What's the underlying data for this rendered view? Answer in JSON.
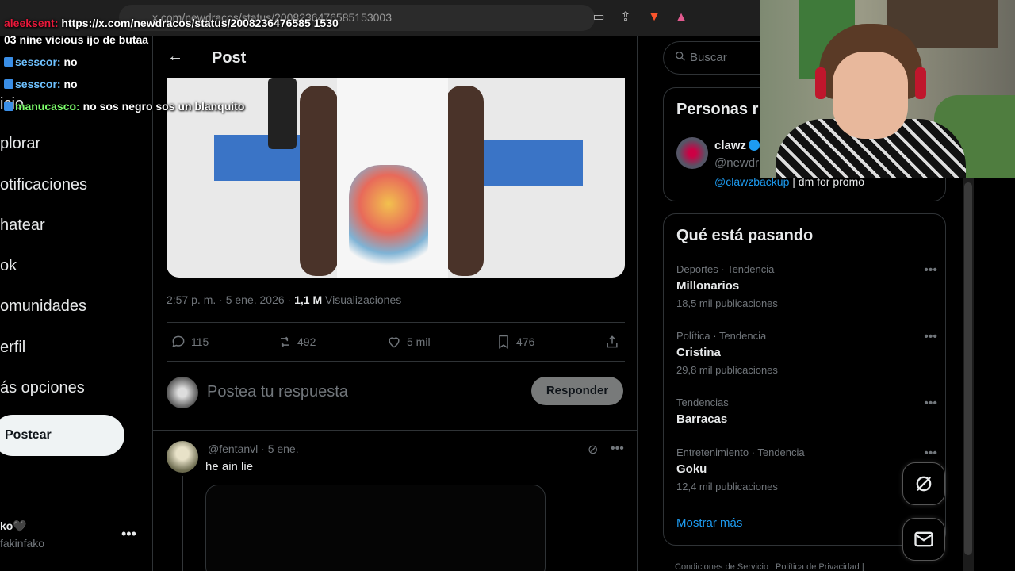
{
  "browser": {
    "url": "x.com/newdracos/status/2008236476585153003",
    "icons": [
      "cast-icon",
      "share-icon",
      "brave-icon",
      "rewards-icon"
    ]
  },
  "chat": {
    "messages": [
      {
        "user": "aleeksent:",
        "text": "https://x.com/newdracos/status/2008236476585 1530"
      },
      {
        "user": "",
        "text": "03 nine vicious ijo de butaa"
      },
      {
        "user": "sesscor:",
        "text": "no"
      },
      {
        "user": "sesscor:",
        "text": "no"
      },
      {
        "user": "manucasco:",
        "text": "no sos negro sos un blanquito"
      }
    ]
  },
  "nav": {
    "items": [
      "icio",
      "plorar",
      "otificaciones",
      "hatear",
      "ok",
      "omunidades",
      "erfil",
      "ás opciones"
    ],
    "post_button": "Postear",
    "account_name": "ko🖤",
    "account_handle": "fakinfako",
    "more": "•••"
  },
  "post": {
    "header_title": "Post",
    "time": "2:57 p. m. · 5 ene. 2026 · ",
    "views_count": "1,1 M",
    "views_label": " Visualizaciones",
    "actions": {
      "replies": "115",
      "reposts": "492",
      "likes": "5 mil",
      "bookmarks": "476"
    },
    "reply_placeholder": "Postea tu respuesta",
    "reply_button": "Responder"
  },
  "comment": {
    "handle": "@fentanvl · 5 ene.",
    "text": "he ain lie",
    "more": "•••"
  },
  "sidebar": {
    "search_placeholder": "Buscar",
    "who_to_follow_title": "Personas r",
    "who": {
      "name": "clawz",
      "handle": "@newdr",
      "bio_mention": "@clawzbackup",
      "bio_text": " | dm for promo"
    },
    "trends_title": "Qué está pasando",
    "trends": [
      {
        "context": "Deportes · Tendencia",
        "name": "Millonarios",
        "count": "18,5 mil publicaciones"
      },
      {
        "context": "Política · Tendencia",
        "name": "Cristina",
        "count": "29,8 mil publicaciones"
      },
      {
        "context": "Tendencias",
        "name": "Barracas",
        "count": ""
      },
      {
        "context": "Entretenimiento · Tendencia",
        "name": "Goku",
        "count": "12,4 mil publicaciones"
      }
    ],
    "show_more": "Mostrar más",
    "footer": "Condiciones de Servicio  |  Política de Privacidad  |"
  },
  "colors": {
    "accent": "#1d9bf0",
    "background": "#000000",
    "text": "#e7e9ea",
    "muted": "#71767b",
    "border": "#2f3336"
  }
}
